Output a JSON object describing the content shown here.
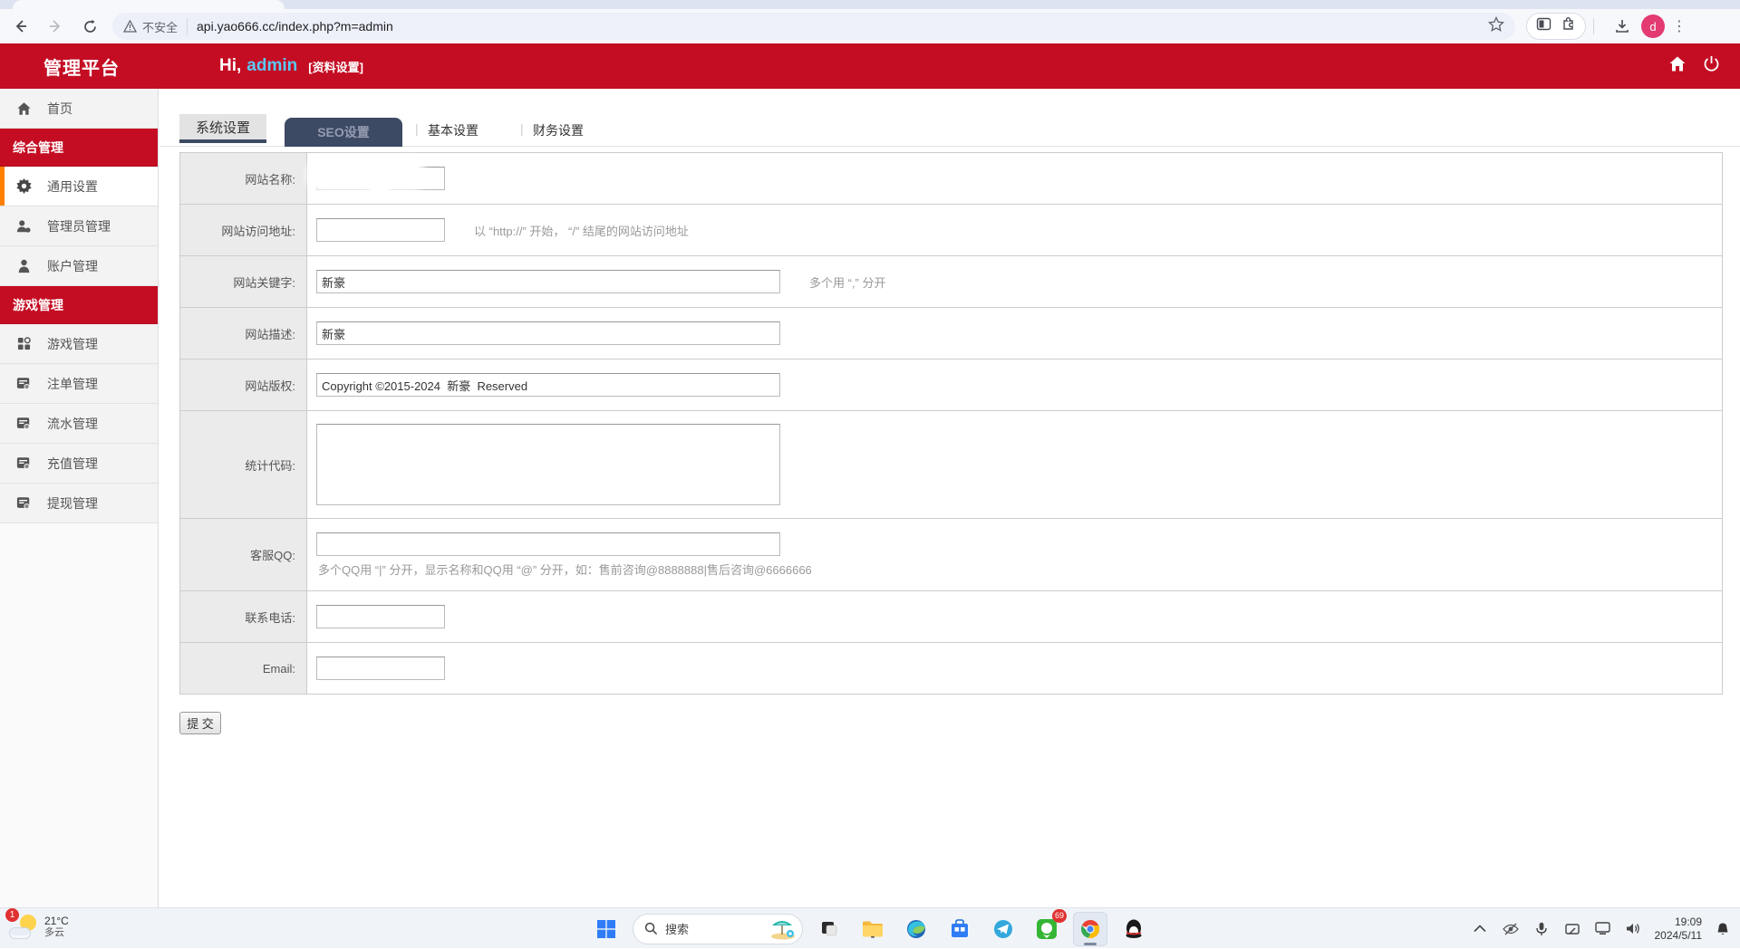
{
  "colors": {
    "accent_red": "#c40d23",
    "tab_navy": "#3d4a63",
    "active_orange": "#ff8000",
    "avatar_pink": "#e23a71",
    "username_blue": "#5bc8f5"
  },
  "browser": {
    "security_label": "不安全",
    "url": "api.yao666.cc/index.php?m=admin",
    "avatar_letter": "d"
  },
  "header": {
    "brand": "管理平台",
    "greeting": "Hi,",
    "username": "admin",
    "profile_link": "[资料设置]"
  },
  "sidebar": {
    "items": [
      {
        "label": "首页",
        "type": "item"
      },
      {
        "label": "综合管理",
        "type": "section"
      },
      {
        "label": "通用设置",
        "type": "item-active"
      },
      {
        "label": "管理员管理",
        "type": "item"
      },
      {
        "label": "账户管理",
        "type": "item"
      },
      {
        "label": "游戏管理",
        "type": "section"
      },
      {
        "label": "游戏管理",
        "type": "item"
      },
      {
        "label": "注单管理",
        "type": "item"
      },
      {
        "label": "流水管理",
        "type": "item"
      },
      {
        "label": "充值管理",
        "type": "item"
      },
      {
        "label": "提现管理",
        "type": "item"
      }
    ]
  },
  "tabs": [
    {
      "label": "系统设置"
    },
    {
      "label": "SEO设置"
    },
    {
      "label": "基本设置"
    },
    {
      "label": "财务设置"
    }
  ],
  "form": {
    "rows": [
      {
        "label": "网站名称:",
        "value": ""
      },
      {
        "label": "网站访问地址:",
        "value": "",
        "hint": "以 “http://” 开始， “/” 结尾的网站访问地址"
      },
      {
        "label": "网站关键字:",
        "value": "新豪",
        "hint": "多个用 “,” 分开"
      },
      {
        "label": "网站描述:",
        "value": "新豪"
      },
      {
        "label": "网站版权:",
        "value": "Copyright ©2015-2024  新豪  Reserved"
      },
      {
        "label": "统计代码:",
        "value": ""
      },
      {
        "label": "客服QQ:",
        "value": "",
        "hint": "多个QQ用 “|” 分开，显示名称和QQ用 “@” 分开，如：售前咨询@8888888|售后咨询@6666666"
      },
      {
        "label": "联系电话:",
        "value": ""
      },
      {
        "label": "Email:",
        "value": ""
      }
    ],
    "submit_label": "提 交"
  },
  "taskbar": {
    "search_placeholder": "搜索",
    "weather": {
      "badge": "1",
      "temp": "21°C",
      "condition": "多云"
    },
    "green_app_badge": "69",
    "clock": {
      "time": "19:09",
      "date": "2024/5/11"
    }
  }
}
